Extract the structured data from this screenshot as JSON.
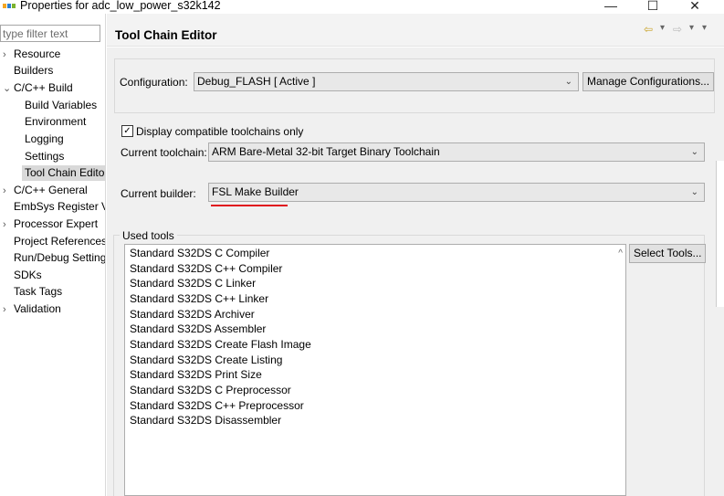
{
  "window": {
    "title": "Properties for adc_low_power_s32k142",
    "minimize_glyph": "—",
    "maximize_glyph": "☐",
    "close_glyph": "✕"
  },
  "filter": {
    "placeholder": "type filter text"
  },
  "nav": {
    "items": [
      {
        "label": "Resource",
        "chevron": "›"
      },
      {
        "label": "Builders",
        "chevron": ""
      },
      {
        "label": "C/C++ Build",
        "chevron": "⌄"
      },
      {
        "label": "Build Variables",
        "chevron": ""
      },
      {
        "label": "Environment",
        "chevron": ""
      },
      {
        "label": "Logging",
        "chevron": ""
      },
      {
        "label": "Settings",
        "chevron": ""
      },
      {
        "label": "Tool Chain Editor",
        "chevron": ""
      },
      {
        "label": "C/C++ General",
        "chevron": "›"
      },
      {
        "label": "EmbSys Register View",
        "chevron": ""
      },
      {
        "label": "Processor Expert",
        "chevron": "›"
      },
      {
        "label": "Project References",
        "chevron": ""
      },
      {
        "label": "Run/Debug Settings",
        "chevron": ""
      },
      {
        "label": "SDKs",
        "chevron": ""
      },
      {
        "label": "Task Tags",
        "chevron": ""
      },
      {
        "label": "Validation",
        "chevron": "›"
      }
    ]
  },
  "header": {
    "title": "Tool Chain Editor",
    "back_glyph": "⇦",
    "forward_glyph": "⇨",
    "dropdown_glyph": "▾",
    "menu_glyph": "▾"
  },
  "config": {
    "label": "Configuration:",
    "value": "Debug_FLASH  [ Active ]",
    "manage_button": "Manage Configurations..."
  },
  "toolchain": {
    "checkbox_label": "Display compatible toolchains only",
    "checkbox_mark": "✓",
    "current_toolchain_label": "Current toolchain:",
    "current_toolchain_value": "ARM Bare-Metal 32-bit Target Binary Toolchain",
    "current_builder_label": "Current builder:",
    "current_builder_value": "FSL Make Builder",
    "dropdown_arrow": "⌄"
  },
  "used_tools": {
    "label": "Used tools",
    "select_button": "Select Tools...",
    "scroll_up_glyph": "^",
    "items": [
      "Standard S32DS C Compiler",
      "Standard S32DS C++ Compiler",
      "Standard S32DS C Linker",
      "Standard S32DS C++ Linker",
      "Standard S32DS Archiver",
      "Standard S32DS Assembler",
      "Standard S32DS Create Flash Image",
      "Standard S32DS Create Listing",
      "Standard S32DS Print Size",
      "Standard S32DS C Preprocessor",
      "Standard S32DS C++ Preprocessor",
      "Standard S32DS Disassembler"
    ]
  },
  "colors": {
    "accent_underline": "#e0141e",
    "selection": "#d9d9d9"
  }
}
